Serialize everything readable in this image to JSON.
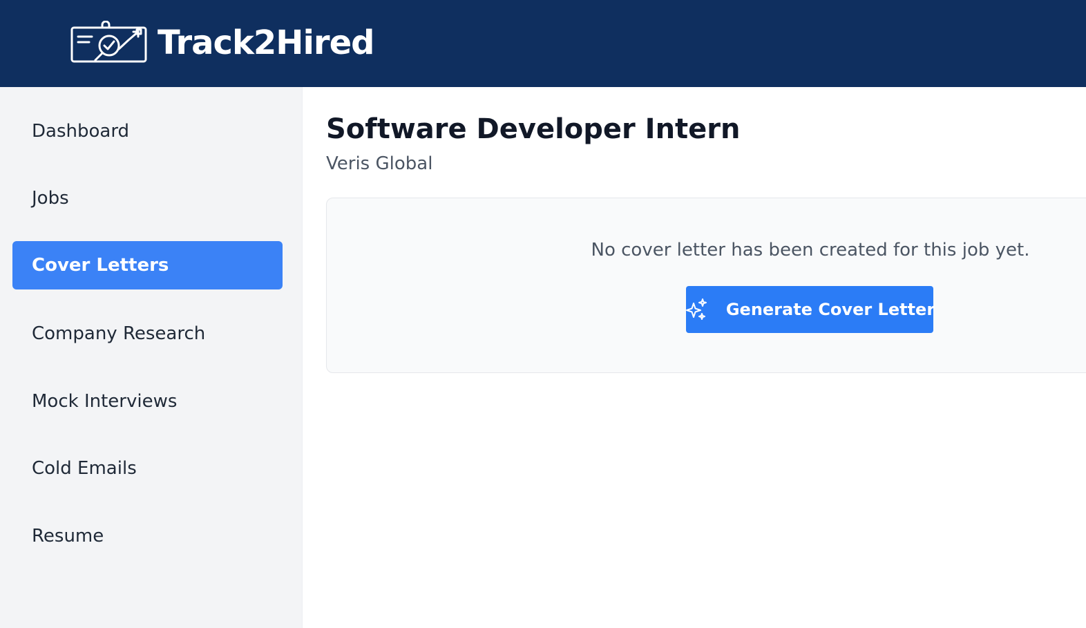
{
  "header": {
    "app_name": "Track2Hired",
    "logo_icon": "id-card-check-icon"
  },
  "sidebar": {
    "items": [
      {
        "label": "Dashboard",
        "active": false
      },
      {
        "label": "Jobs",
        "active": false
      },
      {
        "label": "Cover Letters",
        "active": true
      },
      {
        "label": "Company Research",
        "active": false
      },
      {
        "label": "Mock Interviews",
        "active": false
      },
      {
        "label": "Cold Emails",
        "active": false
      },
      {
        "label": "Resume",
        "active": false
      }
    ]
  },
  "main": {
    "job_title": "Software Developer Intern",
    "company": "Veris Global",
    "empty_state": {
      "message": "No cover letter has been created for this job yet.",
      "button_label": "Generate Cover Letter",
      "button_icon": "sparkles-icon"
    }
  },
  "colors": {
    "header_bg": "#0f2f5f",
    "accent": "#3b82f6",
    "sidebar_bg": "#f3f4f6"
  }
}
